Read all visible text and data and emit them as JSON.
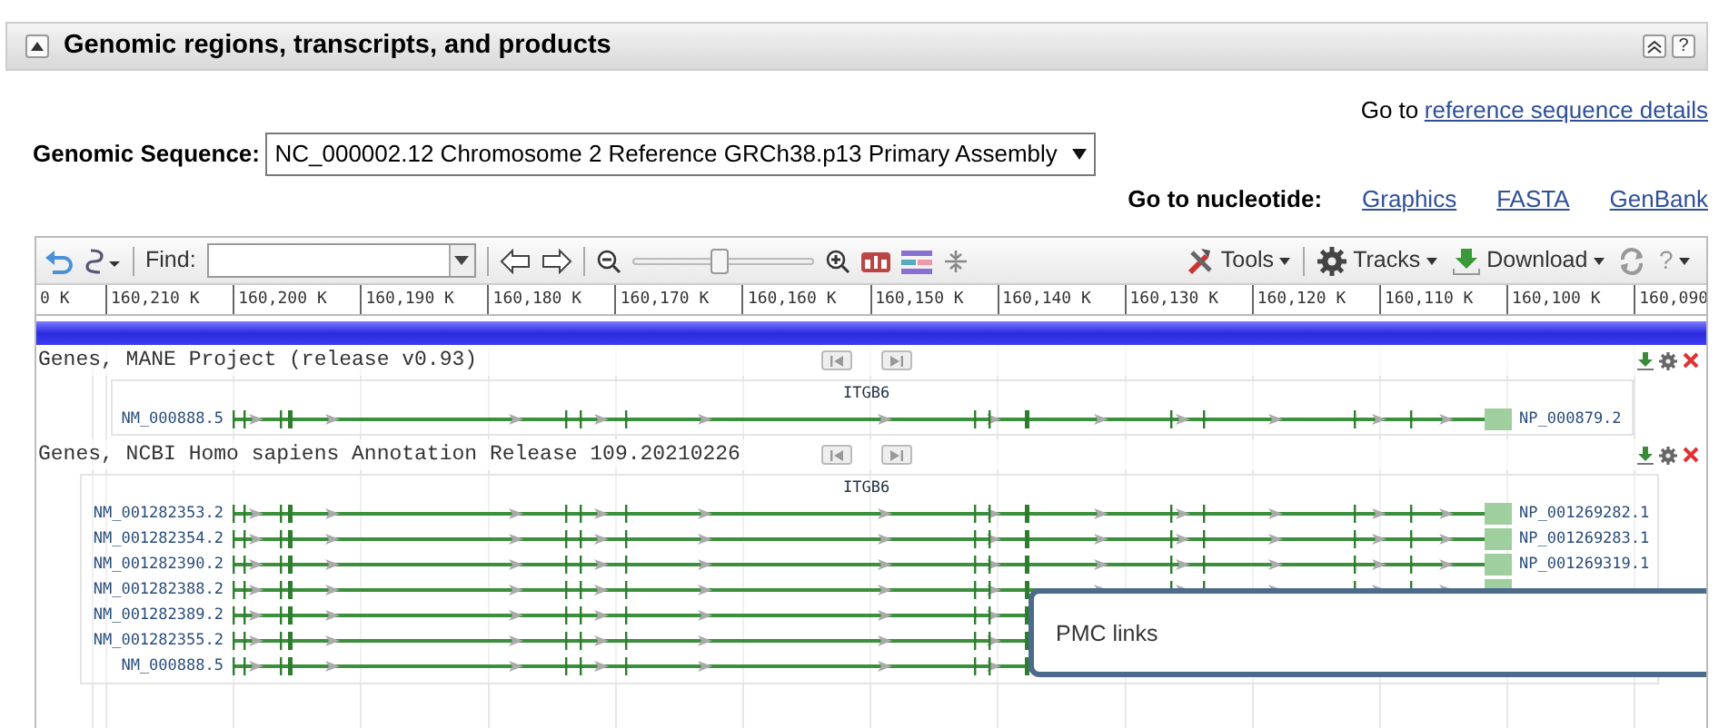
{
  "section": {
    "title": "Genomic regions, transcripts, and products",
    "help": "?"
  },
  "reference_link": {
    "prefix": "Go to",
    "link": "reference sequence details"
  },
  "genomic_sequence": {
    "label": "Genomic Sequence:",
    "value": "NC_000002.12 Chromosome 2 Reference GRCh38.p13 Primary Assembly"
  },
  "nucleotide": {
    "label": "Go to nucleotide:",
    "links": [
      "Graphics",
      "FASTA",
      "GenBank"
    ]
  },
  "viewer": {
    "toolbar": {
      "find_label": "Find:",
      "zoom": {
        "level": 0.48
      },
      "tools": "Tools",
      "tracks": "Tracks",
      "download": "Download",
      "help": "?"
    },
    "ruler": [
      "0 K",
      "160,210 K",
      "160,200 K",
      "160,190 K",
      "160,180 K",
      "160,170 K",
      "160,160 K",
      "160,150 K",
      "160,140 K",
      "160,130 K",
      "160,120 K",
      "160,110 K",
      "160,100 K",
      "160,090"
    ],
    "tracks": [
      {
        "title": "Genes, MANE Project (release v0.93)",
        "gene": "ITGB6",
        "transcripts": [
          {
            "name": "NM_000888.5",
            "product": "NP_000879.2"
          }
        ]
      },
      {
        "title": "Genes, NCBI Homo sapiens Annotation Release 109.20210226",
        "gene": "ITGB6",
        "transcripts": [
          {
            "name": "NM_001282353.2",
            "product": "NP_001269282.1"
          },
          {
            "name": "NM_001282354.2",
            "product": "NP_001269283.1"
          },
          {
            "name": "NM_001282390.2",
            "product": "NP_001269319.1"
          },
          {
            "name": "NM_001282388.2"
          },
          {
            "name": "NM_001282389.2"
          },
          {
            "name": "NM_001282355.2"
          },
          {
            "name": "NM_000888.5"
          }
        ]
      }
    ],
    "popup": {
      "text": "PMC links"
    }
  }
}
